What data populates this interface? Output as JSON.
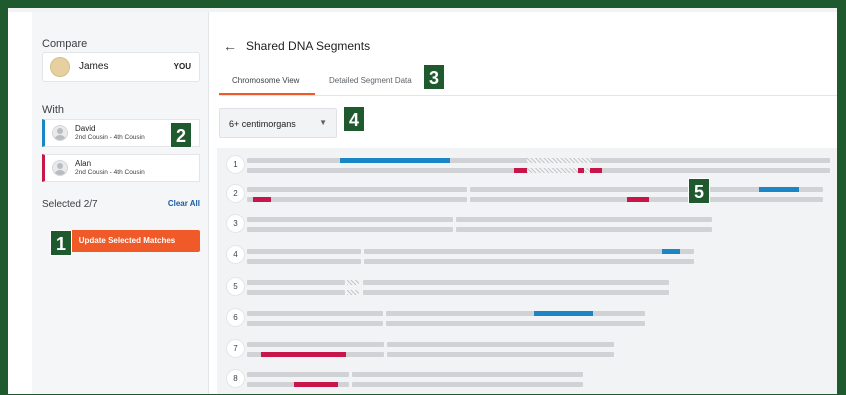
{
  "compare": {
    "label": "Compare",
    "you": {
      "name": "James",
      "tag": "YOU"
    }
  },
  "with": {
    "label": "With",
    "matches": [
      {
        "name": "David",
        "relationship": "2nd Cousin - 4th Cousin",
        "color": "#1b86c6"
      },
      {
        "name": "Alan",
        "relationship": "2nd Cousin - 4th Cousin",
        "color": "#c8154a"
      }
    ]
  },
  "selection": {
    "label": "Selected 2/7",
    "clear_label": "Clear All"
  },
  "update_button": {
    "label": "Update Selected Matches"
  },
  "header": {
    "back_icon": "arrow-left-icon",
    "title": "Shared DNA Segments"
  },
  "tabs": [
    {
      "label": "Chromosome View",
      "active": true
    },
    {
      "label": "Detailed Segment Data",
      "active": false
    }
  ],
  "filter": {
    "value": "6+ centimorgans",
    "caret_icon": "caret-down-icon"
  },
  "callouts": [
    "1",
    "2",
    "3",
    "4",
    "5"
  ],
  "colors": {
    "accent": "#f05a28",
    "match_blue": "#1b86c6",
    "match_red": "#c8154a",
    "callout_green": "#1f5a2e"
  },
  "chromosomes": [
    {
      "number": "1"
    },
    {
      "number": "2"
    },
    {
      "number": "3"
    },
    {
      "number": "4"
    },
    {
      "number": "5"
    },
    {
      "number": "6"
    },
    {
      "number": "7"
    },
    {
      "number": "8"
    }
  ]
}
